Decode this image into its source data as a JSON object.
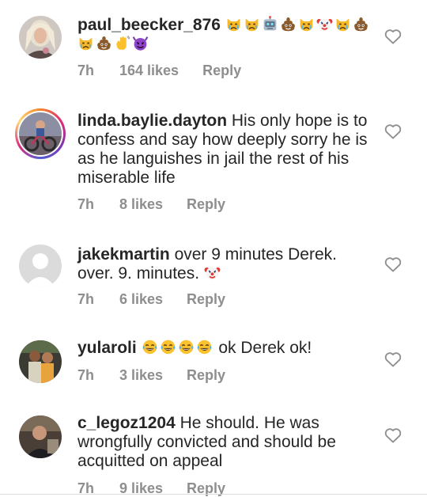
{
  "comments": [
    {
      "username": "paul_beecker_876",
      "text": "",
      "emojis": [
        "crying-cat-emoji",
        "crying-cat-emoji",
        "robot-emoji",
        "poop-emoji",
        "crying-cat-emoji",
        "clown-emoji",
        "crying-cat-emoji",
        "poop-emoji",
        "crying-cat-emoji",
        "poop-emoji",
        "waving-hand-emoji",
        "smiling-devil-emoji"
      ],
      "time": "7h",
      "likes": "164 likes",
      "reply": "Reply"
    },
    {
      "username": "linda.baylie.dayton",
      "text": " His only hope is to confess and say how deeply sorry he is as he languishes in jail the rest of his miserable life",
      "time": "7h",
      "likes": "8 likes",
      "reply": "Reply"
    },
    {
      "username": "jakekmartin",
      "text": " over 9 minutes Derek. over.  9.  minutes. ",
      "emojis_after": [
        "clown-emoji"
      ],
      "time": "7h",
      "likes": "6 likes",
      "reply": "Reply"
    },
    {
      "username": "yularoli",
      "text_before": " ",
      "emojis_inline": [
        "tears-of-joy-emoji",
        "tears-of-joy-emoji",
        "tears-of-joy-emoji",
        "tears-of-joy-emoji"
      ],
      "text": " ok Derek ok!",
      "time": "7h",
      "likes": "3 likes",
      "reply": "Reply"
    },
    {
      "username": "c_legoz1204",
      "text": " He should. He was wrongfully convicted and should be acquitted on appeal",
      "time": "7h",
      "likes": "9 likes",
      "reply": "Reply"
    }
  ],
  "colors": {
    "text": "#262626",
    "meta": "#8e8e8e",
    "heart_outline": "#8e8e8e"
  }
}
